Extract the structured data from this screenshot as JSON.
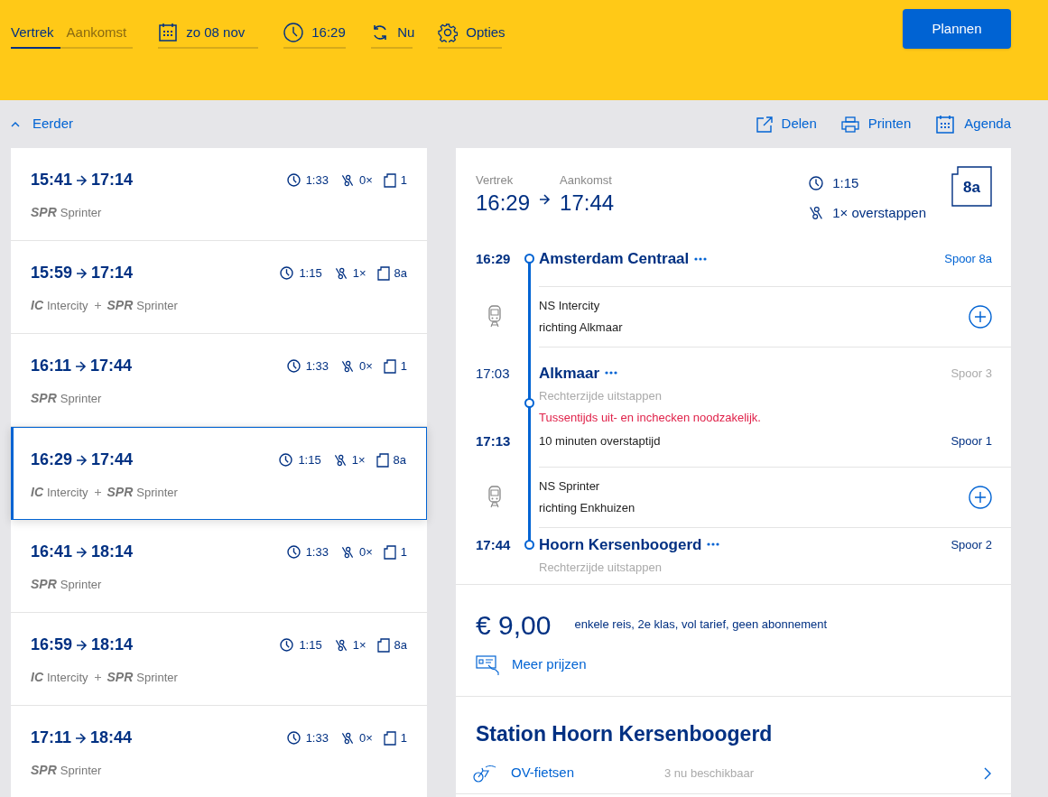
{
  "search": {
    "modes": [
      {
        "label": "Vertrek",
        "selected": true
      },
      {
        "label": "Aankomst",
        "selected": false
      }
    ],
    "date": "zo 08 nov",
    "time": "16:29",
    "now": "Nu",
    "options": "Opties",
    "plan_button": "Plannen"
  },
  "toolbar": {
    "earlier": "Eerder",
    "actions": [
      {
        "kind": "share",
        "label": "Delen"
      },
      {
        "kind": "print",
        "label": "Printen"
      },
      {
        "kind": "calendar",
        "label": "Agenda"
      }
    ]
  },
  "trips": [
    {
      "depart": "15:41",
      "arrive": "17:14",
      "duration": "1:33",
      "transfers": "0×",
      "platform": "1",
      "selected": false,
      "legs": [
        {
          "code": "SPR",
          "name": "Sprinter"
        }
      ]
    },
    {
      "depart": "15:59",
      "arrive": "17:14",
      "duration": "1:15",
      "transfers": "1×",
      "platform": "8a",
      "selected": false,
      "legs": [
        {
          "code": "IC",
          "name": "Intercity"
        },
        {
          "code": "SPR",
          "name": "Sprinter"
        }
      ]
    },
    {
      "depart": "16:11",
      "arrive": "17:44",
      "duration": "1:33",
      "transfers": "0×",
      "platform": "1",
      "selected": false,
      "legs": [
        {
          "code": "SPR",
          "name": "Sprinter"
        }
      ]
    },
    {
      "depart": "16:29",
      "arrive": "17:44",
      "duration": "1:15",
      "transfers": "1×",
      "platform": "8a",
      "selected": true,
      "legs": [
        {
          "code": "IC",
          "name": "Intercity"
        },
        {
          "code": "SPR",
          "name": "Sprinter"
        }
      ]
    },
    {
      "depart": "16:41",
      "arrive": "18:14",
      "duration": "1:33",
      "transfers": "0×",
      "platform": "1",
      "selected": false,
      "legs": [
        {
          "code": "SPR",
          "name": "Sprinter"
        }
      ]
    },
    {
      "depart": "16:59",
      "arrive": "18:14",
      "duration": "1:15",
      "transfers": "1×",
      "platform": "8a",
      "selected": false,
      "legs": [
        {
          "code": "IC",
          "name": "Intercity"
        },
        {
          "code": "SPR",
          "name": "Sprinter"
        }
      ]
    },
    {
      "depart": "17:11",
      "arrive": "18:44",
      "duration": "1:33",
      "transfers": "0×",
      "platform": "1",
      "selected": false,
      "legs": [
        {
          "code": "SPR",
          "name": "Sprinter"
        }
      ]
    }
  ],
  "detail": {
    "departure_label": "Vertrek",
    "arrival_label": "Aankomst",
    "depart": "16:29",
    "arrive": "17:44",
    "duration": "1:15",
    "transfers": "1× overstappen",
    "platform": "8a",
    "timeline": [
      {
        "kind": "stop",
        "time": "16:29",
        "station": "Amsterdam Centraal",
        "platform": "Spoor 8a"
      },
      {
        "kind": "train",
        "service": "NS Intercity",
        "direction": "richting Alkmaar"
      },
      {
        "kind": "transfer",
        "arrival_time": "17:03",
        "station": "Alkmaar",
        "arrival_platform": "Spoor 3",
        "note": "Rechterzijde uitstappen",
        "warning": "Tussentijds uit- en inchecken noodzakelijk.",
        "departure_time": "17:13",
        "transfer_time": "10 minuten overstaptijd",
        "departure_platform": "Spoor 1"
      },
      {
        "kind": "train",
        "service": "NS Sprinter",
        "direction": "richting Enkhuizen"
      },
      {
        "kind": "stop",
        "time": "17:44",
        "station": "Hoorn Kersenboogerd",
        "platform": "Spoor 2",
        "note": "Rechterzijde uitstappen"
      }
    ]
  },
  "fare": {
    "price": "€ 9,00",
    "description": "enkele reis, 2e klas, vol tarief, geen abonnement",
    "more_prices": "Meer prijzen"
  },
  "station": {
    "title": "Station Hoorn Kersenboogerd",
    "facilities": [
      {
        "kind": "bike",
        "label": "OV-fietsen",
        "info": "3 nu beschikbaar"
      }
    ]
  }
}
